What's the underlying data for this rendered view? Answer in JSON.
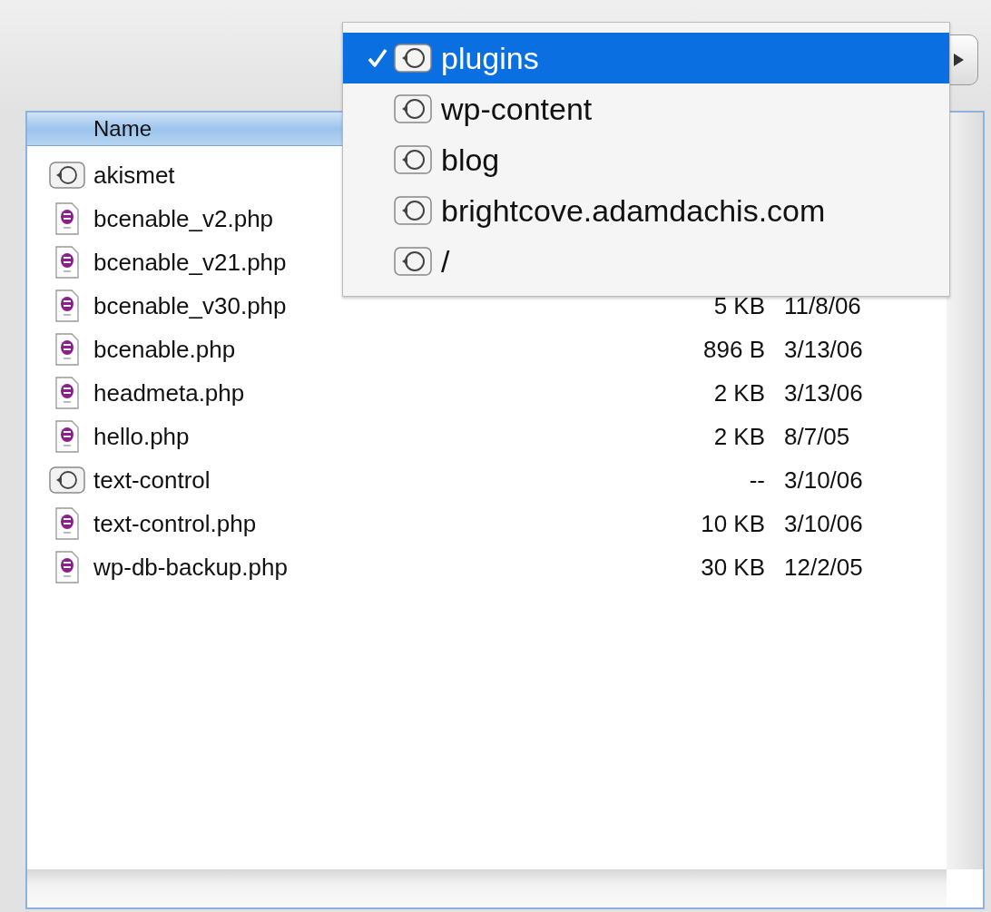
{
  "path_menu": {
    "items": [
      {
        "label": "plugins",
        "selected": true
      },
      {
        "label": "wp-content",
        "selected": false
      },
      {
        "label": "blog",
        "selected": false
      },
      {
        "label": "brightcove.adamdachis.com",
        "selected": false
      },
      {
        "label": "/",
        "selected": false
      }
    ]
  },
  "file_list": {
    "columns": [
      "Name"
    ],
    "rows": [
      {
        "name": "akismet",
        "kind": "folder"
      },
      {
        "name": "bcenable_v2.php",
        "kind": "php"
      },
      {
        "name": "bcenable_v21.php",
        "kind": "php"
      },
      {
        "name": "bcenable_v30.php",
        "kind": "php",
        "size": "5 KB",
        "date": "11/8/06"
      },
      {
        "name": "bcenable.php",
        "kind": "php",
        "size": "896 B",
        "date": "3/13/06"
      },
      {
        "name": "headmeta.php",
        "kind": "php",
        "size": "2 KB",
        "date": "3/13/06"
      },
      {
        "name": "hello.php",
        "kind": "php",
        "size": "2 KB",
        "date": "8/7/05"
      },
      {
        "name": "text-control",
        "kind": "folder",
        "size": "--",
        "date": "3/10/06"
      },
      {
        "name": "text-control.php",
        "kind": "php",
        "size": "10 KB",
        "date": "3/10/06"
      },
      {
        "name": "wp-db-backup.php",
        "kind": "php",
        "size": "30 KB",
        "date": "12/2/05"
      }
    ]
  }
}
